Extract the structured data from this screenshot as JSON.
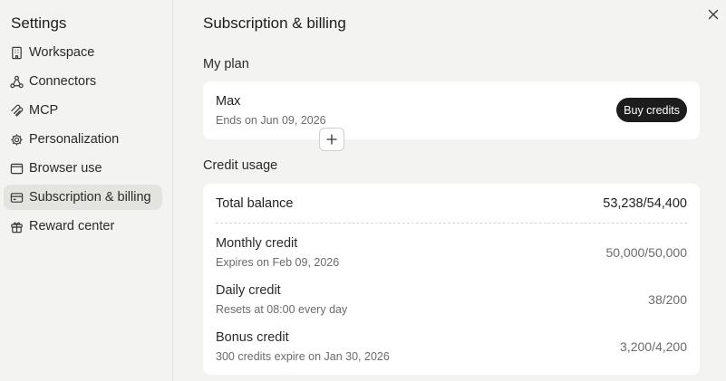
{
  "sidebar": {
    "title": "Settings",
    "items": [
      {
        "label": "Workspace",
        "icon": "building-icon",
        "active": false
      },
      {
        "label": "Connectors",
        "icon": "connectors-icon",
        "active": false
      },
      {
        "label": "MCP",
        "icon": "mcp-icon",
        "active": false
      },
      {
        "label": "Personalization",
        "icon": "gear-icon",
        "active": false
      },
      {
        "label": "Browser use",
        "icon": "browser-icon",
        "active": false
      },
      {
        "label": "Subscription & billing",
        "icon": "credit-card-icon",
        "active": true
      },
      {
        "label": "Reward center",
        "icon": "gift-icon",
        "active": false
      }
    ]
  },
  "main": {
    "title": "Subscription & billing",
    "close_icon": "close-icon",
    "my_plan": {
      "label": "My plan",
      "plan_name": "Max",
      "ends": "Ends on Jun 09, 2026",
      "buy_label": "Buy credits",
      "plus_icon": "plus-icon"
    },
    "credit_usage": {
      "label": "Credit usage",
      "total": {
        "label": "Total balance",
        "value": "53,238/54,400"
      },
      "rows": [
        {
          "name": "Monthly credit",
          "sub": "Expires on Feb 09, 2026",
          "value": "50,000/50,000"
        },
        {
          "name": "Daily credit",
          "sub": "Resets at 08:00 every day",
          "value": "38/200"
        },
        {
          "name": "Bonus credit",
          "sub": "300 credits expire on Jan 30, 2026",
          "value": "3,200/4,200"
        }
      ]
    }
  },
  "colors": {
    "active_bg": "#e3e3df",
    "button_bg": "#1d1d1d",
    "card_bg": "#ffffff",
    "page_bg": "#f3f3f1"
  }
}
